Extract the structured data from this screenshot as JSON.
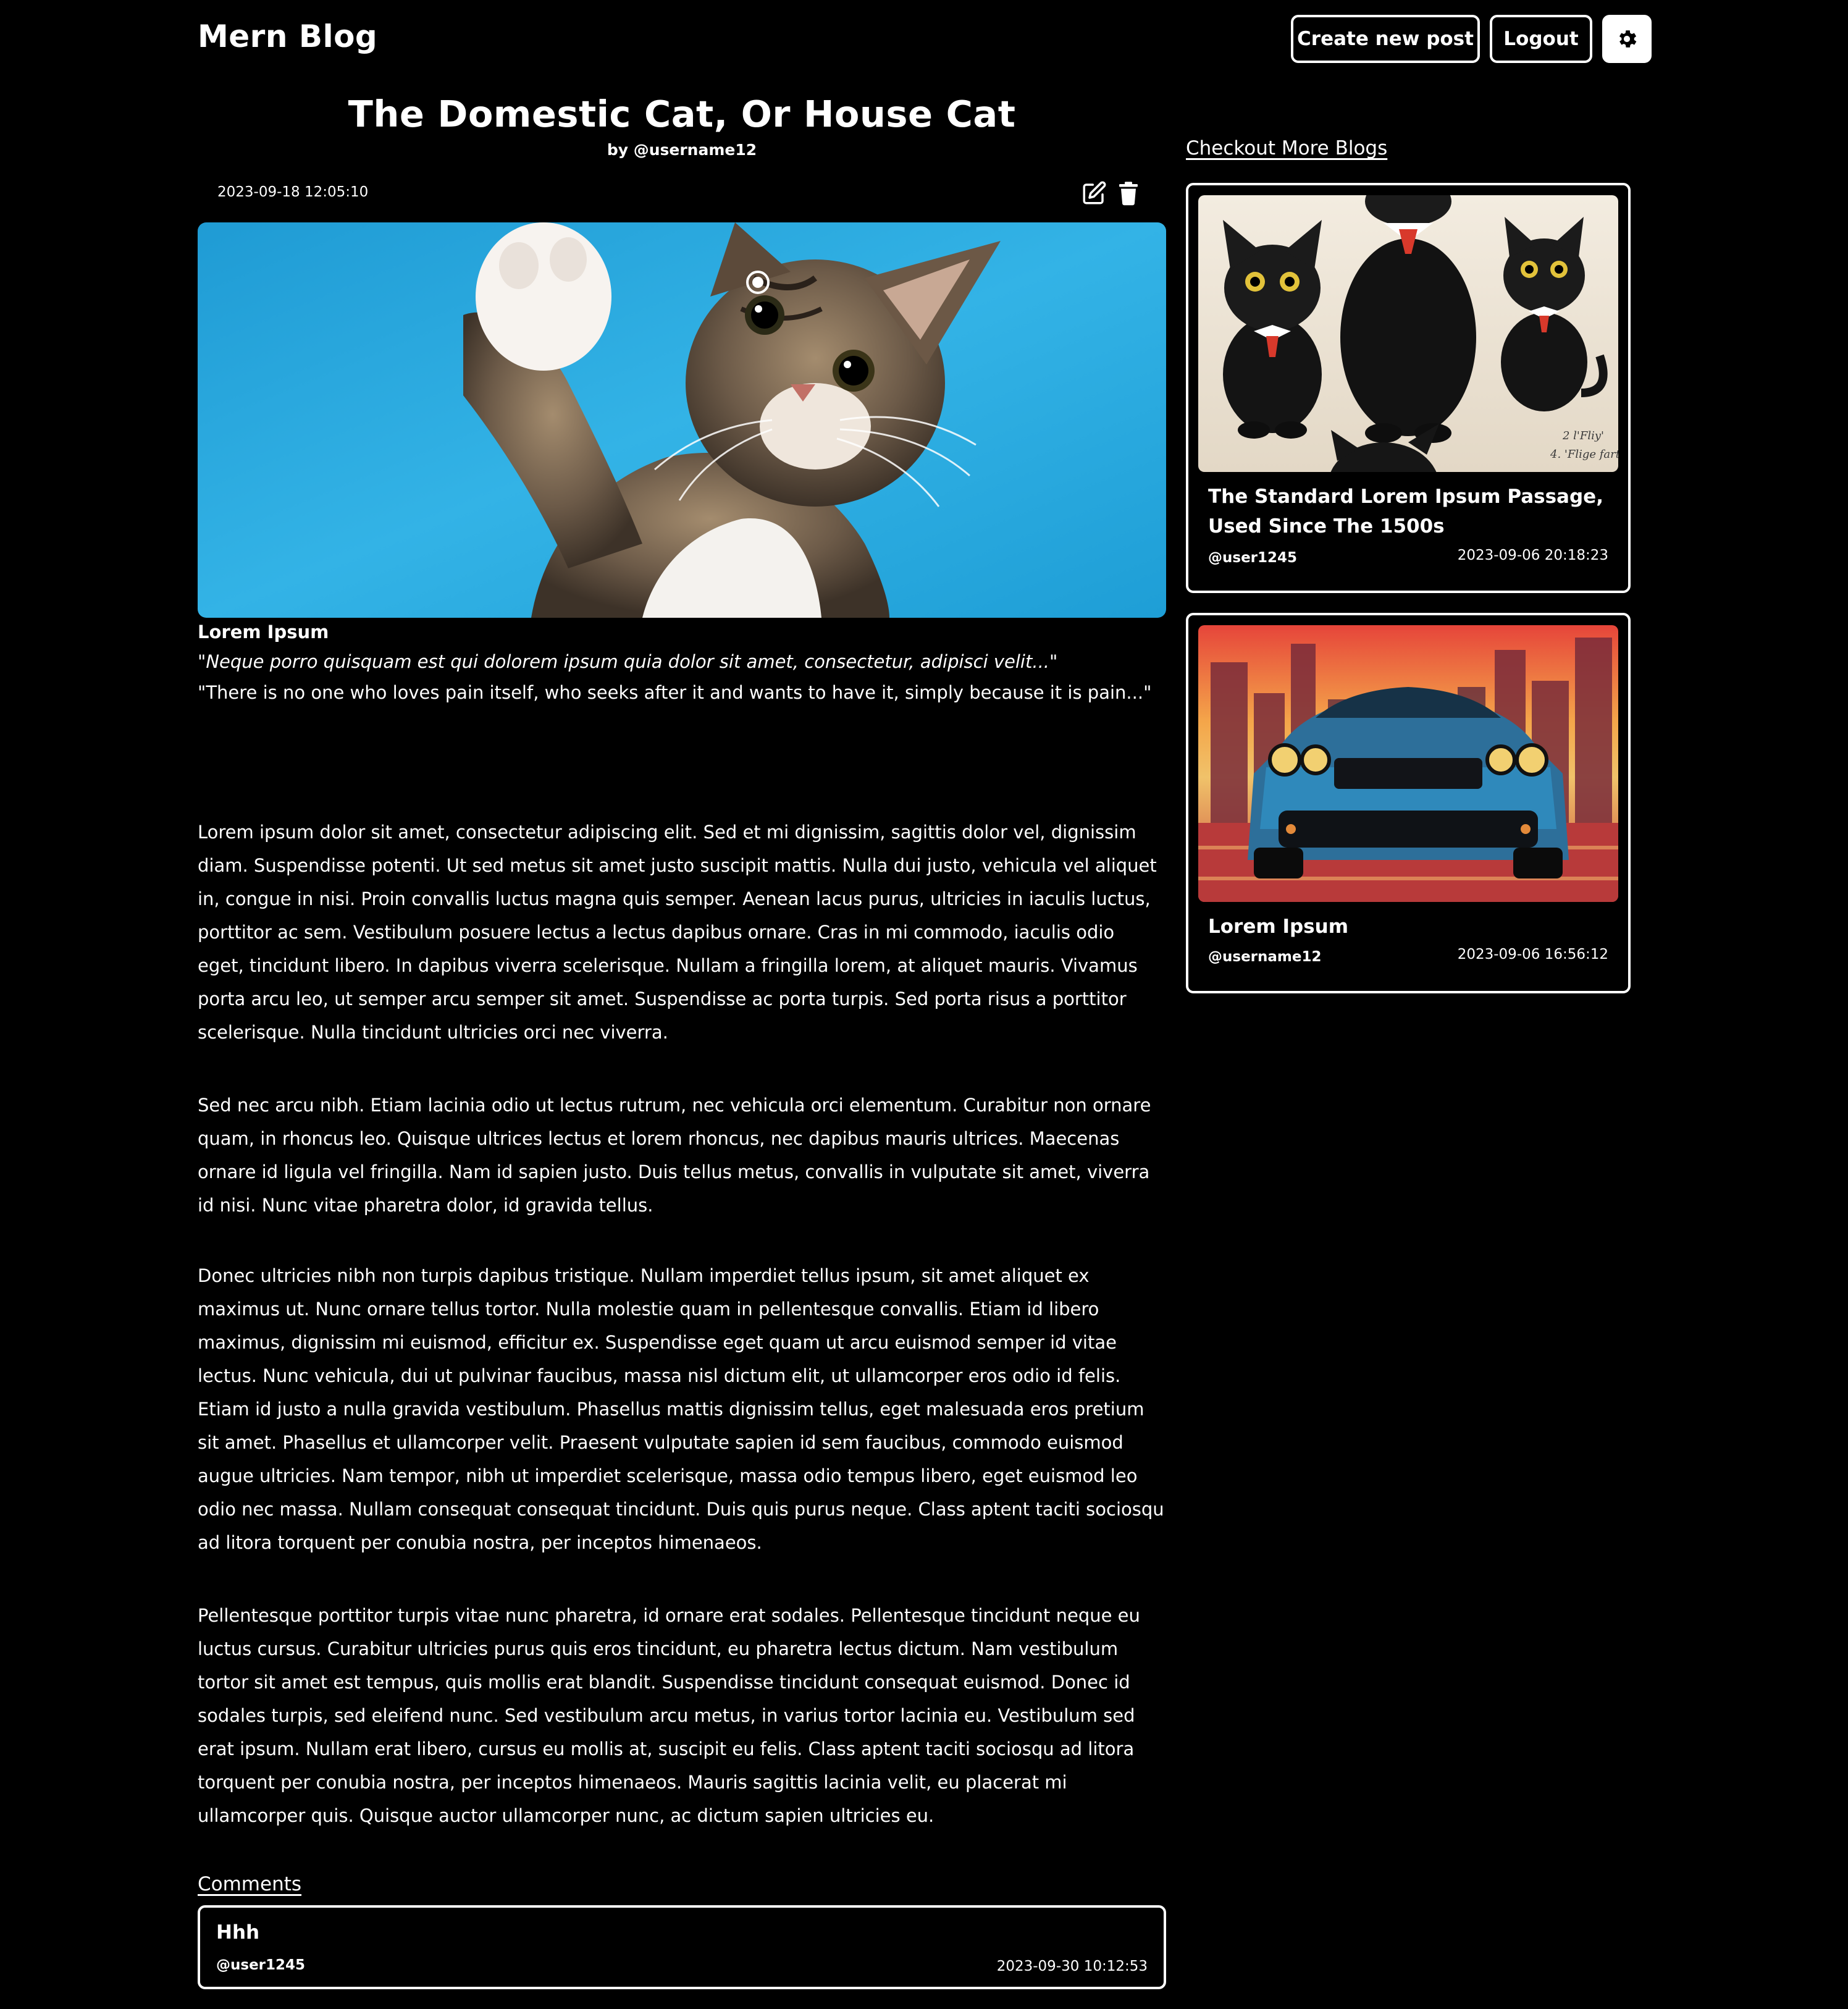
{
  "header": {
    "brand": "Mern Blog",
    "create_label": "Create new post",
    "logout_label": "Logout",
    "theme_icon": "gear-icon"
  },
  "post": {
    "title": "The Domestic Cat, Or House Cat",
    "author": "by @username12",
    "date": "2023-09-18 12:05:10",
    "image_icon": "cat-photo",
    "quote_title": "Lorem Ipsum",
    "quote_latin": "\"Neque porro quisquam est qui dolorem ipsum quia dolor sit amet, consectetur, adipisci velit...\"",
    "quote_english": "\"There is no one who loves pain itself, who seeks after it and wants to have it, simply because it is pain...\"",
    "paragraphs": [
      "Lorem ipsum dolor sit amet, consectetur adipiscing elit. Sed et mi dignissim, sagittis dolor vel, dignissim diam. Suspendisse potenti. Ut sed metus sit amet justo suscipit mattis. Nulla dui justo, vehicula vel aliquet in, congue in nisi. Proin convallis luctus magna quis semper. Aenean lacus purus, ultricies in iaculis luctus, porttitor ac sem. Vestibulum posuere lectus a lectus dapibus ornare. Cras in mi commodo, iaculis odio eget, tincidunt libero. In dapibus viverra scelerisque. Nullam a fringilla lorem, at aliquet mauris. Vivamus porta arcu leo, ut semper arcu semper sit amet. Suspendisse ac porta turpis. Sed porta risus a porttitor scelerisque. Nulla tincidunt ultricies orci nec viverra.",
      "Sed nec arcu nibh. Etiam lacinia odio ut lectus rutrum, nec vehicula orci elementum. Curabitur non ornare quam, in rhoncus leo. Quisque ultrices lectus et lorem rhoncus, nec dapibus mauris ultrices. Maecenas ornare id ligula vel fringilla. Nam id sapien justo. Duis tellus metus, convallis in vulputate sit amet, viverra id nisi. Nunc vitae pharetra dolor, id gravida tellus.",
      "Donec ultricies nibh non turpis dapibus tristique. Nullam imperdiet tellus ipsum, sit amet aliquet ex maximus ut. Nunc ornare tellus tortor. Nulla molestie quam in pellentesque convallis. Etiam id libero maximus, dignissim mi euismod, efficitur ex. Suspendisse eget quam ut arcu euismod semper id vitae lectus. Nunc vehicula, dui ut pulvinar faucibus, massa nisl dictum elit, ut ullamcorper eros odio id felis. Etiam id justo a nulla gravida vestibulum. Phasellus mattis dignissim tellus, eget malesuada eros pretium sit amet. Phasellus et ullamcorper velit. Praesent vulputate sapien id sem faucibus, commodo euismod augue ultricies. Nam tempor, nibh ut imperdiet scelerisque, massa odio tempus libero, eget euismod leo odio nec massa. Nullam consequat consequat tincidunt. Duis quis purus neque. Class aptent taciti sociosqu ad litora torquent per conubia nostra, per inceptos himenaeos.",
      "Pellentesque porttitor turpis vitae nunc pharetra, id ornare erat sodales. Pellentesque tincidunt neque eu luctus cursus. Curabitur ultricies purus quis eros tincidunt, eu pharetra lectus dictum. Nam vestibulum tortor sit amet est tempus, quis mollis erat blandit. Suspendisse tincidunt consequat euismod. Donec id sodales turpis, sed eleifend nunc. Sed vestibulum arcu metus, in varius tortor lacinia eu. Vestibulum sed erat ipsum. Nullam erat libero, cursus eu mollis at, suscipit eu felis. Class aptent taciti sociosqu ad litora torquent per conubia nostra, per inceptos himenaeos. Mauris sagittis lacinia velit, eu placerat mi ullamcorper quis. Quisque auctor ullamcorper nunc, ac dictum sapien ultricies eu."
    ]
  },
  "comments": {
    "heading": "Comments",
    "items": [
      {
        "text": "Hhh",
        "user": "@user1245",
        "date": "2023-09-30 10:12:53"
      }
    ]
  },
  "sidebar": {
    "heading": "Checkout More Blogs",
    "cards": [
      {
        "title": "The Standard Lorem Ipsum Passage, Used Since The 1500s",
        "user": "@user1245",
        "date": "2023-09-06 20:18:23",
        "image": "black-cats-illustration"
      },
      {
        "title": "Lorem Ipsum",
        "user": "@username12",
        "date": "2023-09-06 16:56:12",
        "image": "blue-muscle-car-illustration"
      }
    ]
  },
  "colors": {
    "background": "#000000",
    "text": "#ffffff",
    "hero_sky": "#29a8dc"
  }
}
